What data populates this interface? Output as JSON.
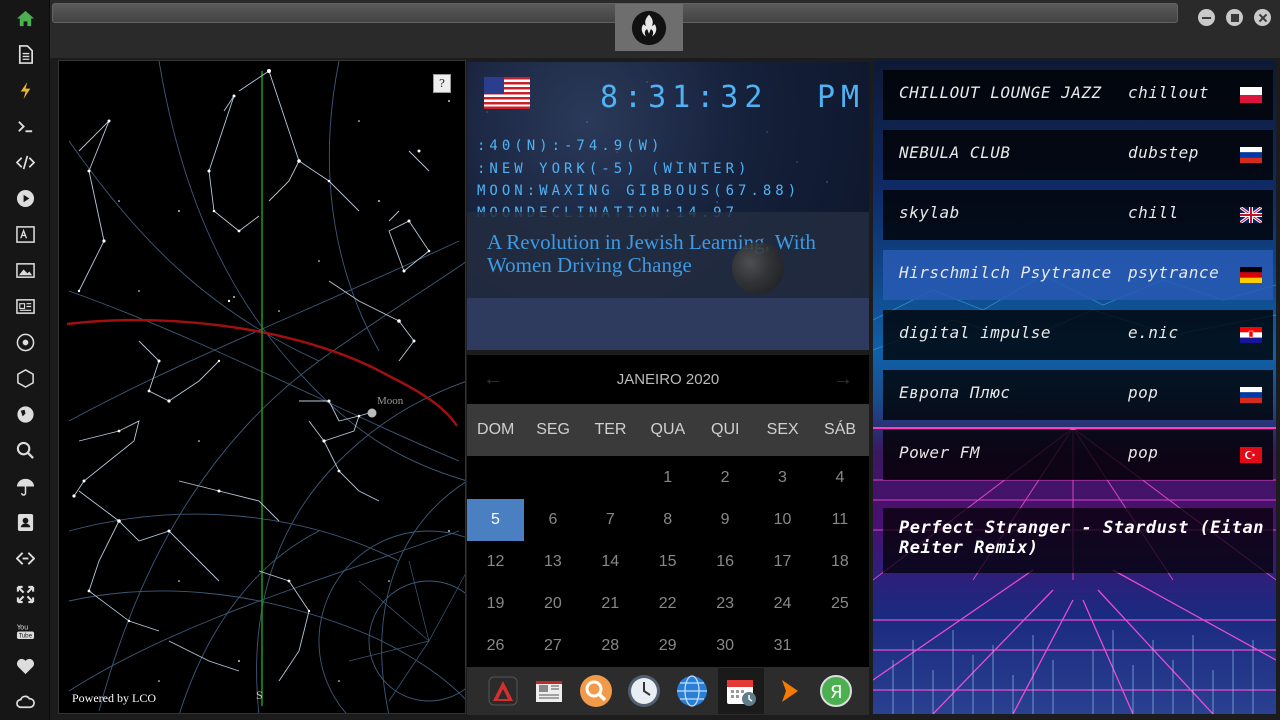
{
  "sidebar": {
    "items": [
      {
        "icon": "home-icon"
      },
      {
        "icon": "document-icon"
      },
      {
        "icon": "lightning-icon"
      },
      {
        "icon": "terminal-icon"
      },
      {
        "icon": "code-icon"
      },
      {
        "icon": "play-icon"
      },
      {
        "icon": "translate-icon"
      },
      {
        "icon": "image-icon"
      },
      {
        "icon": "newspaper-icon"
      },
      {
        "icon": "rebel-icon"
      },
      {
        "icon": "hexagon-icon"
      },
      {
        "icon": "globe-icon"
      },
      {
        "icon": "search-icon"
      },
      {
        "icon": "umbrella-icon"
      },
      {
        "icon": "contact-icon"
      },
      {
        "icon": "code-fork-icon"
      },
      {
        "icon": "expand-icon"
      },
      {
        "icon": "youtube-icon"
      },
      {
        "icon": "heart-icon"
      },
      {
        "icon": "cloud-icon"
      }
    ]
  },
  "skymap": {
    "help": "?",
    "moon_label": "Moon",
    "south_label": "S",
    "powered_by": "Powered by LCO"
  },
  "clock": {
    "time": "8:31:32",
    "ampm": "PM",
    "coords": ":40(N):-74.9(W)",
    "location": ":NEW YORK(-5) (WINTER)",
    "moon_phase": "MOON:WAXING GIBBOUS(67.88)",
    "moon_declination": "MOONDECLINATION:14.97",
    "headline": "A Revolution in Jewish Learning, With Women Driving Change"
  },
  "calendar": {
    "month_label": "JANEIRO 2020",
    "prev": "←",
    "next": "→",
    "weekdays": [
      "DOM",
      "SEG",
      "TER",
      "QUA",
      "QUI",
      "SEX",
      "SÁB"
    ],
    "days": [
      "1",
      "2",
      "3",
      "4",
      "5",
      "6",
      "7",
      "8",
      "9",
      "10",
      "11",
      "12",
      "13",
      "14",
      "15",
      "16",
      "17",
      "18",
      "19",
      "20",
      "21",
      "22",
      "23",
      "24",
      "25",
      "26",
      "27",
      "28",
      "29",
      "30",
      "31"
    ],
    "today": "5"
  },
  "dock": {
    "apps": [
      "drafting-icon",
      "newspaper-app-icon",
      "search-app-icon",
      "clock-app-icon",
      "globe-app-icon",
      "calendar-app-icon",
      "play-app-icon",
      "yandex-icon"
    ]
  },
  "radio": {
    "stations": [
      {
        "name": "CHILLOUT LOUNGE JAZZ",
        "genre": "chillout",
        "flag": "poland"
      },
      {
        "name": "NEBULA CLUB",
        "genre": "dubstep",
        "flag": "russia"
      },
      {
        "name": "skylab",
        "genre": "chill",
        "flag": "uk"
      },
      {
        "name": "Hirschmilch Psytrance",
        "genre": "psytrance",
        "flag": "germany"
      },
      {
        "name": "digital impulse",
        "genre": "e.nic",
        "flag": "croatia"
      },
      {
        "name": "Европа Плюс",
        "genre": "pop",
        "flag": "russia"
      },
      {
        "name": "Power FM",
        "genre": "pop",
        "flag": "turkey"
      }
    ],
    "active_index": 3,
    "now_playing": "Perfect Stranger - Stardust (Eitan Reiter Remix)"
  }
}
